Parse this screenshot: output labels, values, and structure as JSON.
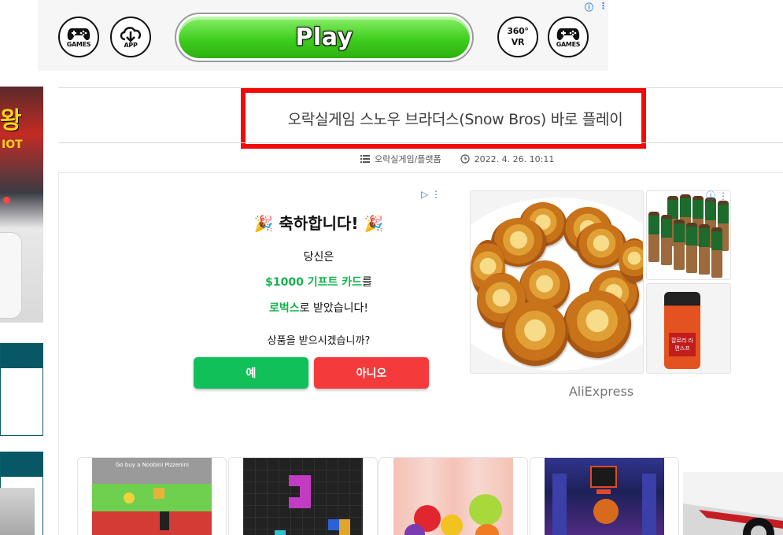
{
  "top_ad": {
    "play_label": "Play",
    "icons": [
      {
        "name": "gamepad-icon",
        "caption": "GAMES"
      },
      {
        "name": "download-cloud-icon",
        "caption": "APP"
      },
      {
        "name": "vr-360-icon",
        "caption": "VR",
        "top": "360°"
      },
      {
        "name": "gamepad-icon",
        "caption": "GAMES"
      }
    ],
    "info_glyph": "ⓘ",
    "more_glyph": "⋮"
  },
  "sidebar": {
    "promo_text_1": "왕",
    "promo_text_2": "IOT"
  },
  "post": {
    "title": "오락실게임 스노우 브라더스(Snow Bros) 바로 플레이",
    "category": "오락실게임/플랫폼",
    "date": "2022. 4. 26. 10:11"
  },
  "gift_ad": {
    "emoji": "🎉",
    "headline": "축하합니다!",
    "line1": "당신은",
    "line2_highlight": "$1000 기프트 카드",
    "line2_rest": "를",
    "line3_highlight": "로벅스",
    "line3_rest": "로 받았습니다!",
    "question": "상품을 받으시겠습니까?",
    "yes_label": "예",
    "no_label": "아니오",
    "adchoices_glyph": "▷ ⋮"
  },
  "ali_ad": {
    "brand": "AliExpress",
    "jar_label": "칼로리 라면스프",
    "adchoices_glyph": "ⓘ ⋮"
  },
  "games": {
    "card1_caption": "Go buy a Noobini Pizzenini"
  },
  "colors": {
    "highlight_border": "#f20a0a",
    "play_green": "#3fce1f",
    "gift_yes": "#12c05a",
    "gift_no": "#f43a3a",
    "gift_text_green": "#14b34e",
    "sidebar_teal": "#075766"
  }
}
